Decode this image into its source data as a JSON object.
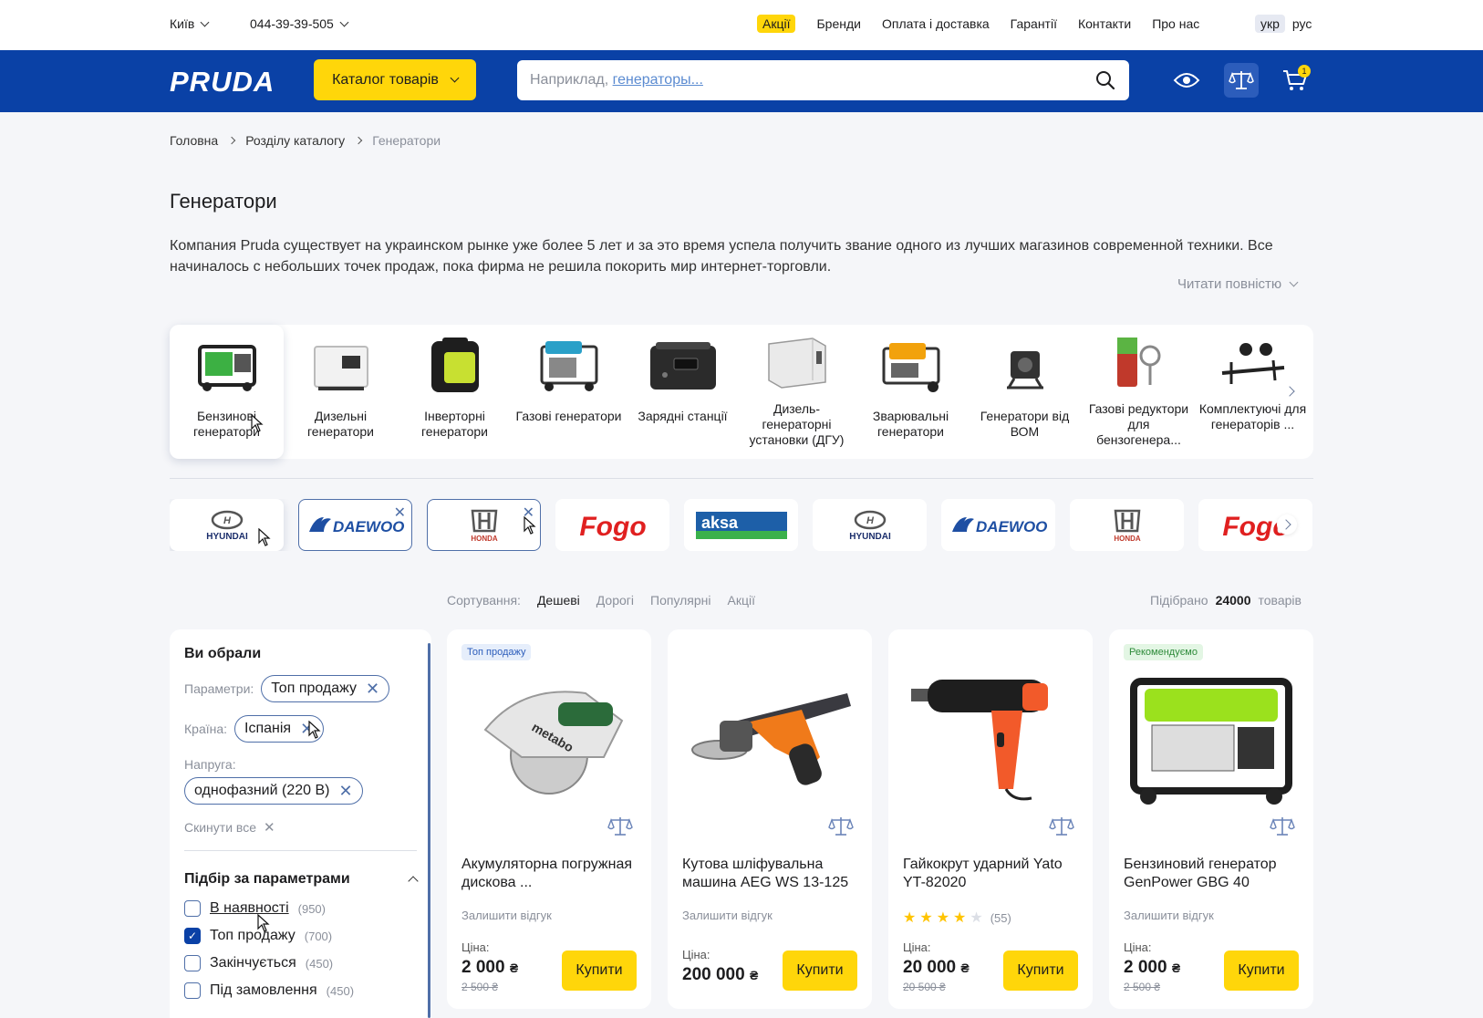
{
  "topbar": {
    "city": "Київ",
    "phone": "044-39-39-505",
    "nav": [
      "Акції",
      "Бренди",
      "Оплата і доставка",
      "Гарантії",
      "Контакти",
      "Про нас"
    ],
    "lang_active": "укр",
    "lang_other": "рус"
  },
  "header": {
    "logo": "PRUDA",
    "catalog_label": "Каталог товарів",
    "search_placeholder_prefix": "Наприклад, ",
    "search_placeholder_link": "генераторы...",
    "cart_count": "1"
  },
  "breadcrumb": [
    "Головна",
    "Розділу каталогу",
    "Генератори"
  ],
  "page": {
    "title": "Генератори",
    "description": "Компания Pruda существует на украинском рынке уже более 5 лет и за это время успела получить звание одного из лучших магазинов современной техники. Все начиналось с небольших точек продаж, пока фирма не решила покорить мир интернет-торговли.",
    "read_more": "Читати повністю"
  },
  "categories": [
    {
      "label": "Бензинові генератори",
      "icon": "gasoline-generator-icon"
    },
    {
      "label": "Дизельні генератори",
      "icon": "diesel-generator-icon"
    },
    {
      "label": "Інверторні генератори",
      "icon": "inverter-generator-icon"
    },
    {
      "label": "Газові генератори",
      "icon": "gas-generator-icon"
    },
    {
      "label": "Зарядні станції",
      "icon": "charging-station-icon"
    },
    {
      "label": "Дизель-генераторні установки (ДГУ)",
      "icon": "diesel-unit-icon"
    },
    {
      "label": "Зварювальні генератори",
      "icon": "welding-generator-icon"
    },
    {
      "label": "Генератори від ВОМ",
      "icon": "pto-generator-icon"
    },
    {
      "label": "Газові редуктори для бензогенера...",
      "icon": "gas-reducer-icon"
    },
    {
      "label": "Комплектуючі для генераторів ...",
      "icon": "generator-parts-icon"
    }
  ],
  "brands": [
    {
      "name": "HYUNDAI",
      "state": "hover"
    },
    {
      "name": "DAEWOO",
      "state": "selected"
    },
    {
      "name": "HONDA",
      "state": "selected"
    },
    {
      "name": "Fogo",
      "state": "normal"
    },
    {
      "name": "aksa",
      "state": "normal"
    },
    {
      "name": "HYUNDAI",
      "state": "normal"
    },
    {
      "name": "DAEWOO",
      "state": "normal"
    },
    {
      "name": "HONDA",
      "state": "normal"
    },
    {
      "name": "Fogo",
      "state": "normal"
    }
  ],
  "sort": {
    "label": "Сортування:",
    "options": [
      "Дешеві",
      "Дорогі",
      "Популярні",
      "Акції"
    ],
    "active": "Дешеві"
  },
  "found": {
    "prefix": "Підібрано",
    "count": "24000",
    "suffix": "товарів"
  },
  "filters": {
    "title": "Ви обрали",
    "param_label": "Параметри:",
    "param_chip": "Топ продажу",
    "country_label": "Країна:",
    "country_chip": "Іспанія",
    "voltage_label": "Напруга:",
    "voltage_chip": "однофазний (220 В)",
    "reset": "Скинути все",
    "params_title": "Підбір за параметрами",
    "checkboxes": [
      {
        "label": "В наявності",
        "count": "(950)",
        "checked": false
      },
      {
        "label": "Топ продажу",
        "count": "(700)",
        "checked": true
      },
      {
        "label": "Закінчується",
        "count": "(450)",
        "checked": false
      },
      {
        "label": "Під замовлення",
        "count": "(450)",
        "checked": false
      }
    ]
  },
  "products": [
    {
      "badge": "Топ продажу",
      "name": "Акумуляторна погружная дискова ...",
      "review": "Залишити відгук",
      "price_label": "Ціна:",
      "price": "2 000",
      "currency": "₴",
      "old_price": "2 500 ₴",
      "buy": "Купити"
    },
    {
      "badge": "",
      "name": "Кутова шліфувальна машина AEG WS 13-125",
      "review": "Залишити відгук",
      "price_label": "Ціна:",
      "price": "200 000",
      "currency": "₴",
      "old_price": "",
      "buy": "Купити"
    },
    {
      "badge": "",
      "name": "Гайкокрут ударний Yato YT-82020",
      "review": "(55)",
      "rating": 4,
      "price_label": "Ціна:",
      "price": "20 000",
      "currency": "₴",
      "old_price": "20 500 ₴",
      "buy": "Купити"
    },
    {
      "badge": "Рекомендуємо",
      "name": "Бензиновий генератор GenPower GBG 40",
      "review": "Залишити відгук",
      "price_label": "Ціна:",
      "price": "2 000",
      "currency": "₴",
      "old_price": "2 500 ₴",
      "buy": "Купити"
    }
  ],
  "colors": {
    "brand_blue": "#0a41a6",
    "accent_yellow": "#ffd60a"
  }
}
